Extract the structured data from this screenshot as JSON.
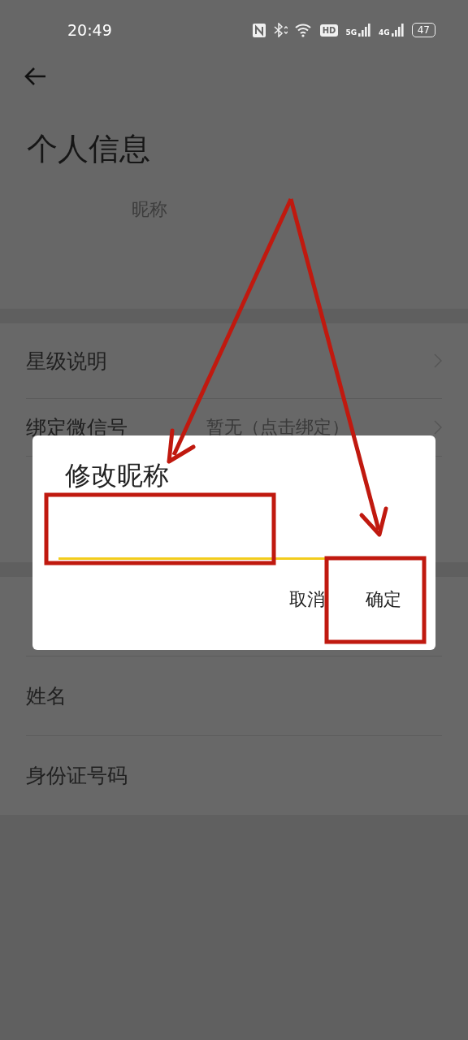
{
  "status_bar": {
    "time": "20:49",
    "icons": [
      {
        "kind": "nfc"
      },
      {
        "kind": "bluetooth"
      },
      {
        "kind": "wifi"
      },
      {
        "kind": "hd",
        "label": "HD"
      },
      {
        "kind": "signal",
        "label": "5G"
      },
      {
        "kind": "signal",
        "label": "4G"
      }
    ],
    "battery": "47"
  },
  "header": {
    "title": "个人信息",
    "nickname_label": "昵称"
  },
  "rows": [
    {
      "label": "星级说明",
      "chevron": true
    },
    {
      "label": "绑定微信号",
      "value": "暂无（点击绑定）",
      "chevron": true
    }
  ],
  "lower_rows": [
    {
      "label": "姓名"
    },
    {
      "label": "身份证号码"
    }
  ],
  "dialog": {
    "title": "修改昵称",
    "input": {
      "focused": true
    },
    "buttons": [
      {
        "label": "取消"
      },
      {
        "label": "确定"
      }
    ]
  }
}
